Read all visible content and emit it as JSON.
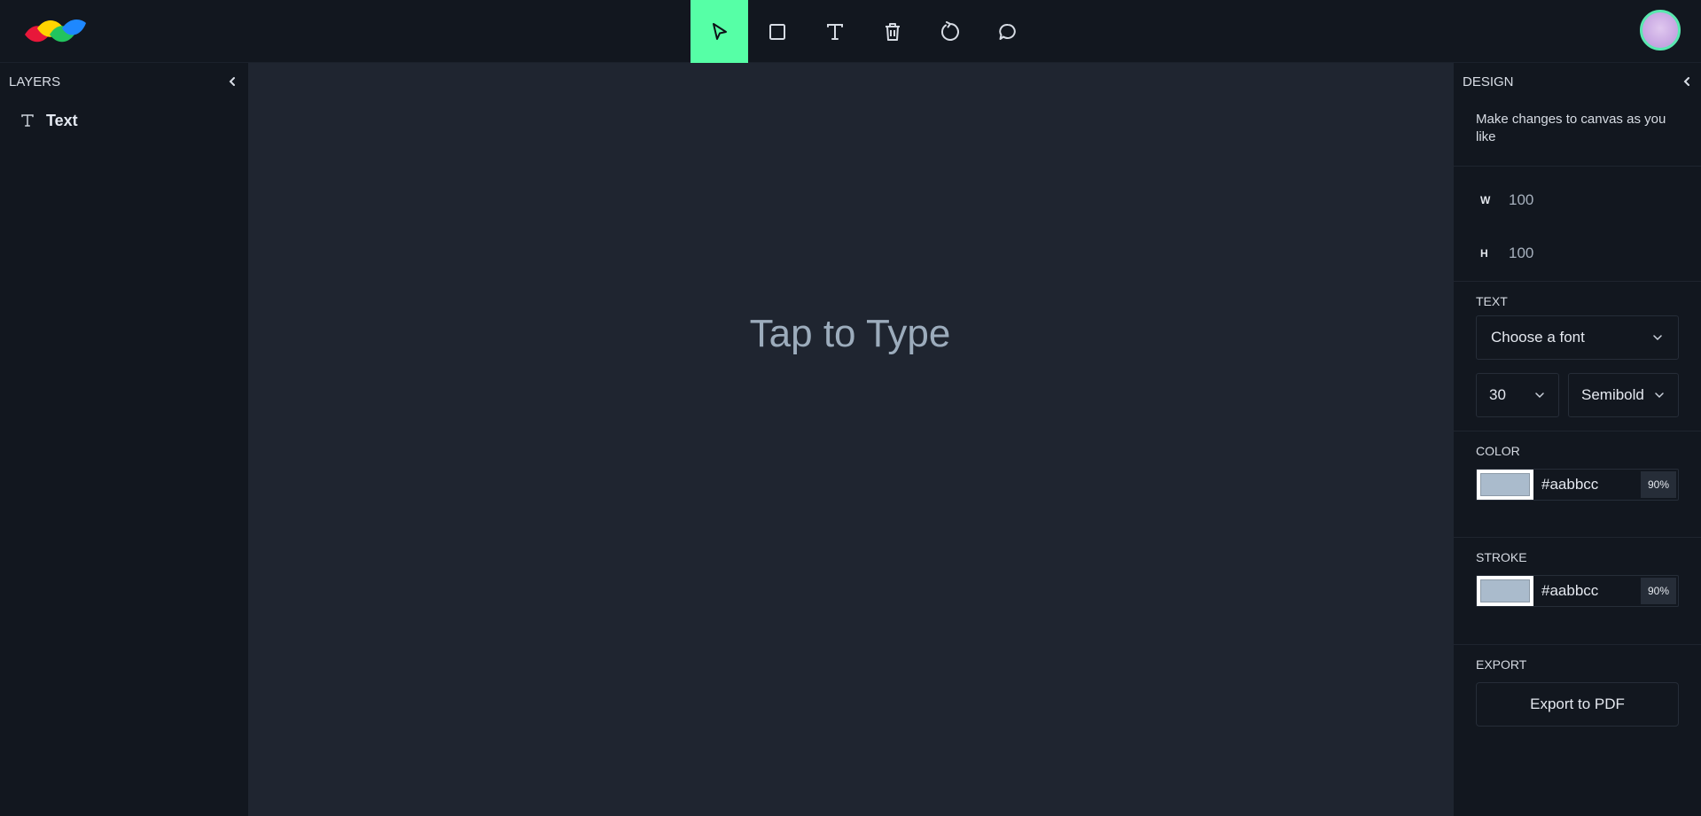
{
  "toolbar": {
    "tools": [
      {
        "name": "select",
        "active": true
      },
      {
        "name": "rectangle",
        "active": false
      },
      {
        "name": "text",
        "active": false
      },
      {
        "name": "delete",
        "active": false
      },
      {
        "name": "reset",
        "active": false
      },
      {
        "name": "comment",
        "active": false
      }
    ],
    "accent": "#56ffa6"
  },
  "layers": {
    "title": "LAYERS",
    "items": [
      {
        "label": "Text",
        "icon": "text-icon"
      }
    ]
  },
  "canvas": {
    "text": "Tap to Type",
    "text_color": "#aabbcc"
  },
  "design": {
    "title": "DESIGN",
    "description": "Make changes to canvas as you like",
    "width_label": "W",
    "width_value": "100",
    "height_label": "H",
    "height_value": "100",
    "text_section": "TEXT",
    "font_family": "Choose a font",
    "font_size": "30",
    "font_weight": "Semibold",
    "color_section": "COLOR",
    "color_hex": "#aabbcc",
    "color_opacity": "90%",
    "stroke_section": "STROKE",
    "stroke_hex": "#aabbcc",
    "stroke_opacity": "90%",
    "export_section": "EXPORT",
    "export_label": "Export to PDF"
  }
}
